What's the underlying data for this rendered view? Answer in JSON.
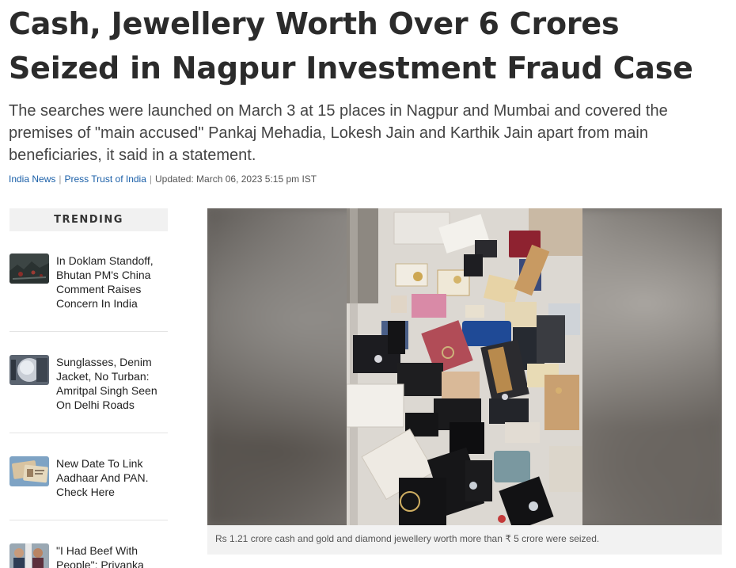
{
  "article": {
    "headline": "Cash, Jewellery Worth Over 6 Crores Seized in Nagpur Investment Fraud Case",
    "summary": "The searches were launched on March 3 at 15 places in Nagpur and Mumbai and covered the premises of \"main accused\" Pankaj Mehadia, Lokesh Jain and Karthik Jain apart from main beneficiaries, it said in a statement.",
    "byline": {
      "category": "India News",
      "agency": "Press Trust of India",
      "updated": "Updated: March 06, 2023 5:15 pm IST"
    },
    "image_caption": "Rs 1.21 crore cash and gold and diamond jewellery worth more than ₹ 5 crore were seized."
  },
  "sidebar": {
    "heading": "TRENDING",
    "items": [
      {
        "title": "In Doklam Standoff, Bhutan PM's China Comment Raises Concern In India"
      },
      {
        "title": "Sunglasses, Denim Jacket, No Turban: Amritpal Singh Seen On Delhi Roads"
      },
      {
        "title": "New Date To Link Aadhaar And PAN. Check Here"
      },
      {
        "title": "\"I Had Beef With People\": Priyanka"
      }
    ]
  },
  "colors": {
    "link": "#1a5fa8",
    "trending_bg": "#f1f1f1",
    "caption_bg": "#f2f2f2"
  }
}
